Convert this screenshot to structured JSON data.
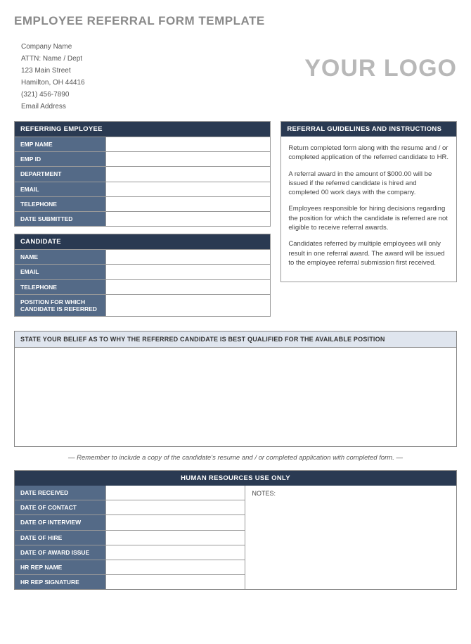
{
  "title": "EMPLOYEE REFERRAL FORM TEMPLATE",
  "company": {
    "name": "Company Name",
    "attn": "ATTN: Name / Dept",
    "street": "123 Main Street",
    "city": "Hamilton, OH  44416",
    "phone": "(321) 456-7890",
    "email": "Email Address"
  },
  "logo_text": "YOUR LOGO",
  "referring_employee": {
    "header": "REFERRING EMPLOYEE",
    "fields": [
      {
        "label": "EMP NAME",
        "value": ""
      },
      {
        "label": "EMP ID",
        "value": ""
      },
      {
        "label": "DEPARTMENT",
        "value": ""
      },
      {
        "label": "EMAIL",
        "value": ""
      },
      {
        "label": "TELEPHONE",
        "value": ""
      },
      {
        "label": "DATE SUBMITTED",
        "value": ""
      }
    ]
  },
  "candidate": {
    "header": "CANDIDATE",
    "fields": [
      {
        "label": "NAME",
        "value": ""
      },
      {
        "label": "EMAIL",
        "value": ""
      },
      {
        "label": "TELEPHONE",
        "value": ""
      },
      {
        "label": "POSITION FOR WHICH CANDIDATE IS REFERRED",
        "value": ""
      }
    ]
  },
  "guidelines": {
    "header": "REFERRAL GUIDELINES AND INSTRUCTIONS",
    "p1": "Return completed form along with the resume and / or completed application of the referred candidate to HR.",
    "p2": "A referral award in the amount of $000.00 will be issued if the referred candidate is hired and completed 00 work days with the company.",
    "p3": "Employees responsible for hiring decisions regarding the position for which the candidate is referred are not eligible to receive referral awards.",
    "p4": "Candidates referred by multiple employees will only result in one referral award.  The award will be issued to the employee referral submission first received."
  },
  "belief": {
    "header": "STATE YOUR BELIEF AS TO WHY THE REFERRED CANDIDATE IS BEST QUALIFIED FOR THE AVAILABLE POSITION",
    "value": ""
  },
  "reminder": "— Remember to include a copy of the candidate's resume and / or completed application with completed form. —",
  "hr": {
    "header": "HUMAN RESOURCES USE ONLY",
    "fields": [
      {
        "label": "DATE RECEIVED",
        "value": ""
      },
      {
        "label": "DATE OF CONTACT",
        "value": ""
      },
      {
        "label": "DATE OF INTERVIEW",
        "value": ""
      },
      {
        "label": "DATE OF HIRE",
        "value": ""
      },
      {
        "label": "DATE OF AWARD ISSUE",
        "value": ""
      },
      {
        "label": "HR REP NAME",
        "value": ""
      },
      {
        "label": "HR REP SIGNATURE",
        "value": ""
      }
    ],
    "notes_label": "NOTES:",
    "notes_value": ""
  }
}
